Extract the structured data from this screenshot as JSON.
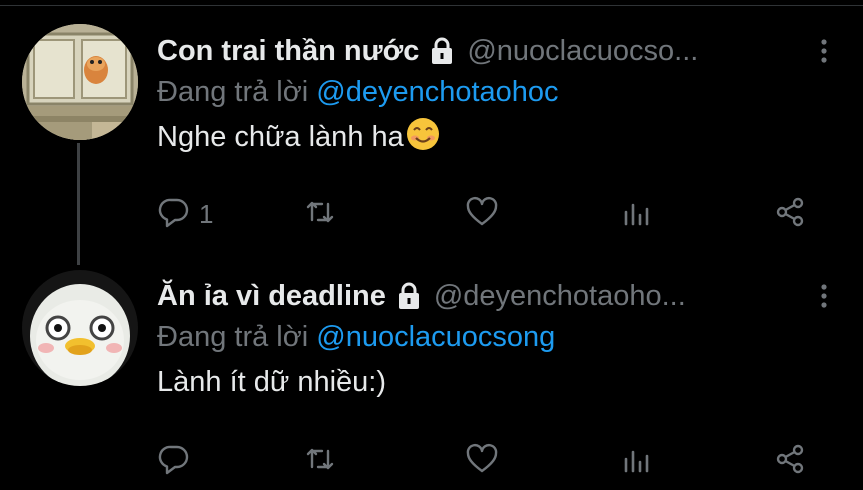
{
  "thread": [
    {
      "display_name": "Con trai thần nước",
      "handle": "@nuoclacuocso...",
      "reply_prefix": "Đang trả lời",
      "reply_to": "@deyenchotaohoc",
      "text": "Nghe chữa lành ha",
      "text_emoji": "smiling-face-emoji",
      "reply_count": "1",
      "protected": true
    },
    {
      "display_name": "Ăn ỉa vì deadline",
      "handle": "@deyenchotaoho...",
      "reply_prefix": "Đang trả lời",
      "reply_to": "@nuoclacuocsong",
      "text": "Lành ít dữ nhiều:)",
      "reply_count": "",
      "protected": true
    }
  ],
  "icons": {
    "reply": "reply-icon",
    "retweet": "retweet-icon",
    "like": "heart-icon",
    "stats": "analytics-icon",
    "share": "share-icon",
    "more": "more-vertical-icon",
    "lock": "lock-icon"
  },
  "colors": {
    "background": "#000000",
    "text": "#e7e9ea",
    "secondary": "#71767b",
    "link": "#1d9bf0",
    "thread_line": "#3e4144"
  }
}
